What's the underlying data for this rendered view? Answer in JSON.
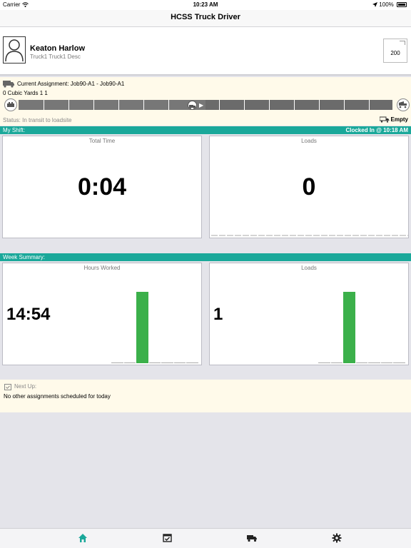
{
  "statusbar": {
    "carrier": "Carrier",
    "time": "10:23 AM",
    "battery": "100%"
  },
  "app": {
    "title": "HCSS Truck Driver"
  },
  "profile": {
    "name": "Keaton  Harlow",
    "truck": "Truck1 Truck1 Desc",
    "badge": "200"
  },
  "assignment": {
    "current": "Current Assignment: Job90-A1 - Job90-A1",
    "quantity": "0 Cubic Yards 1 1",
    "status": "Status: In transit to loadsite",
    "load_state": "Empty"
  },
  "shift": {
    "header": "My Shift:",
    "clock": "Clocked In @  10:18 AM",
    "total_time_label": "Total Time",
    "total_time": "0:04",
    "loads_label": "Loads",
    "loads": "0"
  },
  "week": {
    "header": "Week Summary:",
    "hours_label": "Hours Worked",
    "hours": "14:54",
    "loads_label": "Loads",
    "loads": "1",
    "hours_chart": {
      "type": "bar",
      "values": [
        0,
        0,
        14.9,
        0,
        0,
        0,
        0
      ]
    },
    "loads_chart": {
      "type": "bar",
      "values": [
        0,
        0,
        1,
        0,
        0,
        0,
        0
      ]
    }
  },
  "next_up": {
    "label": "Next Up:",
    "message": "No other assignments scheduled for today"
  },
  "colors": {
    "teal": "#1aa89a",
    "bar": "#3bb04a",
    "tab_active": "#1aa89a",
    "tab_inactive": "#222222"
  },
  "tabs": [
    "home-icon",
    "calendar-check-icon",
    "truck-icon",
    "gear-icon"
  ]
}
